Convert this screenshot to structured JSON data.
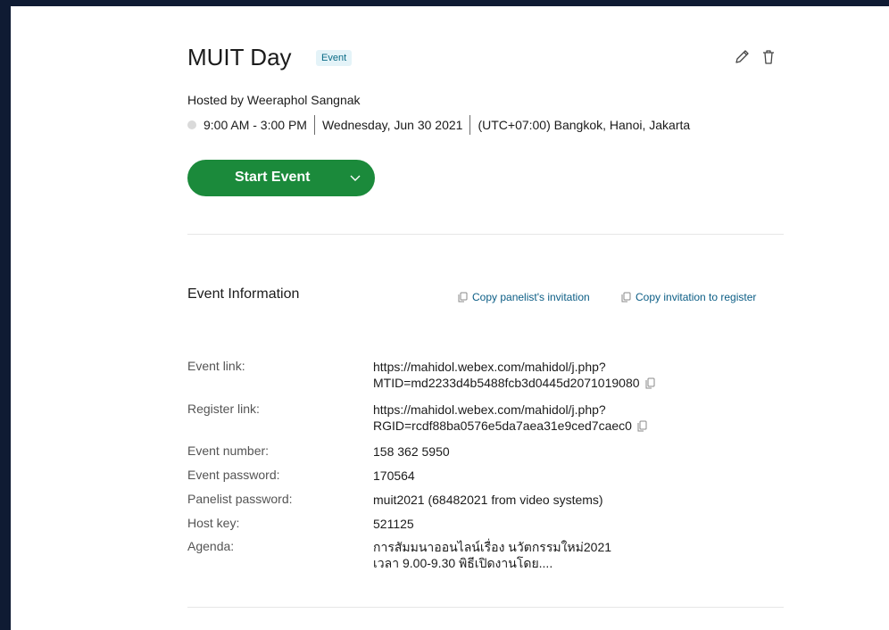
{
  "event": {
    "title": "MUIT Day",
    "badge": "Event",
    "host": "Hosted by Weeraphol Sangnak",
    "time": "9:00 AM - 3:00 PM",
    "date": "Wednesday, Jun 30 2021",
    "timezone": "(UTC+07:00) Bangkok, Hanoi, Jakarta"
  },
  "actions": {
    "start_label": "Start Event"
  },
  "info": {
    "section_title": "Event Information",
    "copy_panelist": "Copy panelist's invitation",
    "copy_register": "Copy invitation to register",
    "rows": [
      {
        "label": "Event link:",
        "line1": "https://mahidol.webex.com/mahidol/j.php?",
        "line2": "MTID=md2233d4b5488fcb3d0445d2071019080"
      },
      {
        "label": "Register link:",
        "line1": "https://mahidol.webex.com/mahidol/j.php?",
        "line2": "RGID=rcdf88ba0576e5da7aea31e9ced7caec0"
      },
      {
        "label": "Event number:",
        "line1": "158 362 5950"
      },
      {
        "label": "Event password:",
        "line1": "170564"
      },
      {
        "label": "Panelist password:",
        "line1": "muit2021 (68482021 from video systems)"
      },
      {
        "label": "Host key:",
        "line1": "521125"
      },
      {
        "label": "Agenda:",
        "line1": "การสัมมนาออนไลน์เรื่อง นวัตกรรมใหม่2021",
        "line2": "เวลา 9.00-9.30 พิธีเปิดงานโดย...."
      }
    ]
  },
  "icons": {
    "edit": "pencil-icon",
    "delete": "trash-icon",
    "dropdown": "chevron-down-icon",
    "copy": "copy-icon"
  },
  "colors": {
    "start_button": "#1b8a3b",
    "link": "#0b5d85",
    "badge_bg": "#e4f3f8",
    "badge_text": "#0a6b86"
  }
}
